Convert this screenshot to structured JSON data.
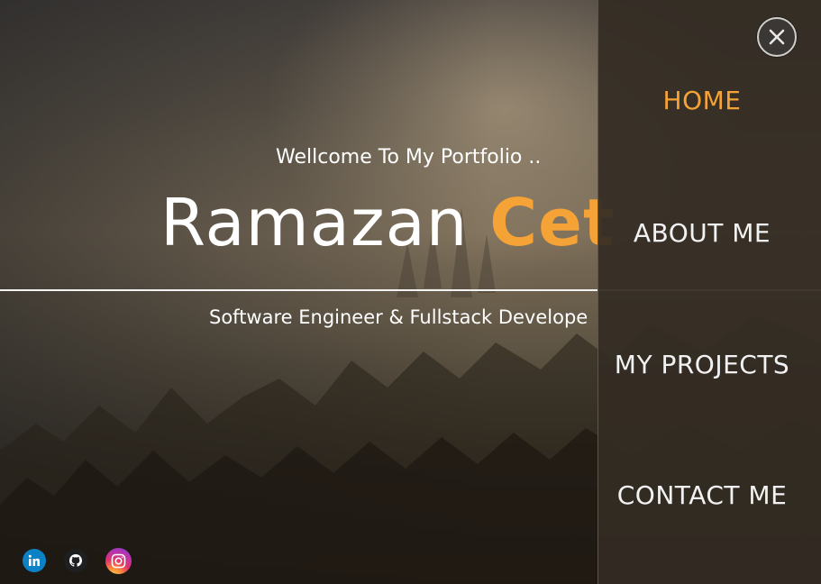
{
  "hero": {
    "welcome": "Wellcome To My Portfolio ..",
    "name_first": "Ramazan",
    "name_last": "Cet",
    "subtitle": "Software Engineer & Fullstack Develope"
  },
  "menu": {
    "items": [
      {
        "label": "HOME",
        "active": true
      },
      {
        "label": "ABOUT ME",
        "active": false
      },
      {
        "label": "MY PROJECTS",
        "active": false
      },
      {
        "label": "CONTACT ME",
        "active": false
      }
    ],
    "close_icon": "close-icon"
  },
  "socials": [
    {
      "icon": "linkedin-icon"
    },
    {
      "icon": "github-icon"
    },
    {
      "icon": "instagram-icon"
    }
  ],
  "colors": {
    "accent": "#f5a236",
    "text": "#ffffff",
    "menu_bg": "#342c24"
  }
}
